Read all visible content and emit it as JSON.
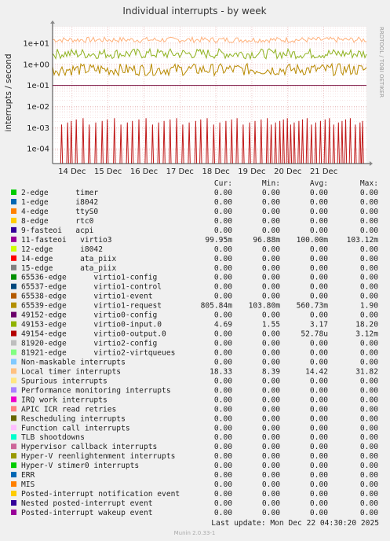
{
  "chart_data": {
    "type": "line",
    "title": "Individual interrupts - by week",
    "ylabel": "interrupts / second",
    "side_label": "RRDTOOL / TOBI OETIKER",
    "yscale": "log",
    "ylim": [
      2e-05,
      60
    ],
    "y_ticks": [
      {
        "value": 10,
        "label": "1e+01"
      },
      {
        "value": 1,
        "label": "1e+00"
      },
      {
        "value": 0.1,
        "label": "1e-01"
      },
      {
        "value": 0.01,
        "label": "1e-02"
      },
      {
        "value": 0.001,
        "label": "1e-03"
      },
      {
        "value": 0.0001,
        "label": "1e-04"
      }
    ],
    "xlim": [
      "2025-12-13T11:00",
      "2025-12-22T04:30"
    ],
    "x_ticks": [
      {
        "value": "2025-12-14T00:00",
        "label": "14 Dec"
      },
      {
        "value": "2025-12-15T00:00",
        "label": "15 Dec"
      },
      {
        "value": "2025-12-16T00:00",
        "label": "16 Dec"
      },
      {
        "value": "2025-12-17T00:00",
        "label": "17 Dec"
      },
      {
        "value": "2025-12-18T00:00",
        "label": "18 Dec"
      },
      {
        "value": "2025-12-19T00:00",
        "label": "19 Dec"
      },
      {
        "value": "2025-12-20T00:00",
        "label": "20 Dec"
      },
      {
        "value": "2025-12-21T00:00",
        "label": "21 Dec"
      }
    ],
    "grid": true,
    "series_lines": [
      {
        "name": "Local timer interrupts",
        "color": "#ffb07a",
        "level": 14.42,
        "low": 8.39,
        "high": 31.82
      },
      {
        "name": "49153-edge virtio0-input.0",
        "color": "#8fb21f",
        "level": 3.17,
        "low": 1.55,
        "high": 18.2
      },
      {
        "name": "65539-edge virtio1-request",
        "color": "#b88a00",
        "level": 0.56073,
        "low": 0.1038,
        "high": 1.9
      },
      {
        "name": "11-fasteoi virtio3",
        "color": "#7a1040",
        "level": 0.1,
        "low": 0.09688,
        "high": 0.10312
      },
      {
        "name": "49154-edge virtio0-output.0",
        "color": "#c01818",
        "spikes": true,
        "low": 1e-05,
        "high": 0.00312
      }
    ],
    "spike_days": [
      0.25,
      0.42,
      0.52,
      0.66,
      0.85,
      1.02,
      1.2,
      1.38,
      1.52,
      1.72,
      1.9,
      2.08,
      2.22,
      2.4,
      2.6,
      2.78,
      2.95,
      3.1,
      3.27,
      3.45,
      3.62,
      3.8,
      3.98,
      4.12,
      4.3,
      4.48,
      4.65,
      4.82,
      4.98,
      5.13,
      5.3,
      5.48,
      5.63,
      5.8,
      5.97,
      6.08,
      6.2,
      6.32,
      6.42,
      6.53,
      6.62,
      6.72,
      6.85,
      6.95,
      7.08,
      7.2,
      7.32,
      7.45,
      7.58,
      7.7,
      7.82,
      7.95,
      8.05,
      8.15,
      8.28,
      8.42,
      8.55,
      8.62
    ],
    "columns": [
      "Cur:",
      "Min:",
      "Avg:",
      "Max:"
    ],
    "legend": [
      {
        "label": "2-edge      timer",
        "color": "#00cc00",
        "cur": "0.00",
        "min": "0.00",
        "avg": "0.00",
        "max": "0.00"
      },
      {
        "label": "1-edge      i8042",
        "color": "#0066b3",
        "cur": "0.00",
        "min": "0.00",
        "avg": "0.00",
        "max": "0.00"
      },
      {
        "label": "4-edge      ttyS0",
        "color": "#ff8000",
        "cur": "0.00",
        "min": "0.00",
        "avg": "0.00",
        "max": "0.00"
      },
      {
        "label": "8-edge      rtc0",
        "color": "#ffcc00",
        "cur": "0.00",
        "min": "0.00",
        "avg": "0.00",
        "max": "0.00"
      },
      {
        "label": "9-fasteoi   acpi",
        "color": "#330099",
        "cur": "0.00",
        "min": "0.00",
        "avg": "0.00",
        "max": "0.00"
      },
      {
        "label": "11-fasteoi   virtio3",
        "color": "#990099",
        "cur": "99.95m",
        "min": "96.88m",
        "avg": "100.00m",
        "max": "103.12m"
      },
      {
        "label": "12-edge      i8042",
        "color": "#ccff00",
        "cur": "0.00",
        "min": "0.00",
        "avg": "0.00",
        "max": "0.00"
      },
      {
        "label": "14-edge      ata_piix",
        "color": "#ff0000",
        "cur": "0.00",
        "min": "0.00",
        "avg": "0.00",
        "max": "0.00"
      },
      {
        "label": "15-edge      ata_piix",
        "color": "#808080",
        "cur": "0.00",
        "min": "0.00",
        "avg": "0.00",
        "max": "0.00"
      },
      {
        "label": "65536-edge      virtio1-config",
        "color": "#008f00",
        "cur": "0.00",
        "min": "0.00",
        "avg": "0.00",
        "max": "0.00"
      },
      {
        "label": "65537-edge      virtio1-control",
        "color": "#00487d",
        "cur": "0.00",
        "min": "0.00",
        "avg": "0.00",
        "max": "0.00"
      },
      {
        "label": "65538-edge      virtio1-event",
        "color": "#b35a00",
        "cur": "0.00",
        "min": "0.00",
        "avg": "0.00",
        "max": "0.00"
      },
      {
        "label": "65539-edge      virtio1-request",
        "color": "#b38f00",
        "cur": "805.84m",
        "min": "103.80m",
        "avg": "560.73m",
        "max": "1.90"
      },
      {
        "label": "49152-edge      virtio0-config",
        "color": "#6b006b",
        "cur": "0.00",
        "min": "0.00",
        "avg": "0.00",
        "max": "0.00"
      },
      {
        "label": "49153-edge      virtio0-input.0",
        "color": "#8fb300",
        "cur": "4.69",
        "min": "1.55",
        "avg": "3.17",
        "max": "18.20"
      },
      {
        "label": "49154-edge      virtio0-output.0",
        "color": "#b30000",
        "cur": "0.00",
        "min": "0.00",
        "avg": "52.78u",
        "max": "3.12m"
      },
      {
        "label": "81920-edge      virtio2-config",
        "color": "#bebebe",
        "cur": "0.00",
        "min": "0.00",
        "avg": "0.00",
        "max": "0.00"
      },
      {
        "label": "81921-edge      virtio2-virtqueues",
        "color": "#80ff80",
        "cur": "0.00",
        "min": "0.00",
        "avg": "0.00",
        "max": "0.00"
      },
      {
        "label": "Non-maskable interrupts",
        "color": "#80c9ff",
        "cur": "0.00",
        "min": "0.00",
        "avg": "0.00",
        "max": "0.00"
      },
      {
        "label": "Local timer interrupts",
        "color": "#ffc080",
        "cur": "18.33",
        "min": "8.39",
        "avg": "14.42",
        "max": "31.82"
      },
      {
        "label": "Spurious interrupts",
        "color": "#ffe680",
        "cur": "0.00",
        "min": "0.00",
        "avg": "0.00",
        "max": "0.00"
      },
      {
        "label": "Performance monitoring interrupts",
        "color": "#aa80ff",
        "cur": "0.00",
        "min": "0.00",
        "avg": "0.00",
        "max": "0.00"
      },
      {
        "label": "IRQ work interrupts",
        "color": "#ee00cc",
        "cur": "0.00",
        "min": "0.00",
        "avg": "0.00",
        "max": "0.00"
      },
      {
        "label": "APIC ICR read retries",
        "color": "#ff8080",
        "cur": "0.00",
        "min": "0.00",
        "avg": "0.00",
        "max": "0.00"
      },
      {
        "label": "Rescheduling interrupts",
        "color": "#666600",
        "cur": "0.00",
        "min": "0.00",
        "avg": "0.00",
        "max": "0.00"
      },
      {
        "label": "Function call interrupts",
        "color": "#ffbfff",
        "cur": "0.00",
        "min": "0.00",
        "avg": "0.00",
        "max": "0.00"
      },
      {
        "label": "TLB shootdowns",
        "color": "#00ffcc",
        "cur": "0.00",
        "min": "0.00",
        "avg": "0.00",
        "max": "0.00"
      },
      {
        "label": "Hypervisor callback interrupts",
        "color": "#cc6699",
        "cur": "0.00",
        "min": "0.00",
        "avg": "0.00",
        "max": "0.00"
      },
      {
        "label": "Hyper-V reenlightenment interrupts",
        "color": "#999900",
        "cur": "0.00",
        "min": "0.00",
        "avg": "0.00",
        "max": "0.00"
      },
      {
        "label": "Hyper-V stimer0 interrupts",
        "color": "#00cc00",
        "cur": "0.00",
        "min": "0.00",
        "avg": "0.00",
        "max": "0.00"
      },
      {
        "label": "ERR",
        "color": "#0066b3",
        "cur": "0.00",
        "min": "0.00",
        "avg": "0.00",
        "max": "0.00"
      },
      {
        "label": "MIS",
        "color": "#ff8000",
        "cur": "0.00",
        "min": "0.00",
        "avg": "0.00",
        "max": "0.00"
      },
      {
        "label": "Posted-interrupt notification event",
        "color": "#ffcc00",
        "cur": "0.00",
        "min": "0.00",
        "avg": "0.00",
        "max": "0.00"
      },
      {
        "label": "Nested posted-interrupt event",
        "color": "#330099",
        "cur": "0.00",
        "min": "0.00",
        "avg": "0.00",
        "max": "0.00"
      },
      {
        "label": "Posted-interrupt wakeup event",
        "color": "#990099",
        "cur": "0.00",
        "min": "0.00",
        "avg": "0.00",
        "max": "0.00"
      }
    ],
    "last_update": "Last update:  Mon Dec 22 04:30:20 2025",
    "footer": "Munin 2.0.33-1"
  }
}
